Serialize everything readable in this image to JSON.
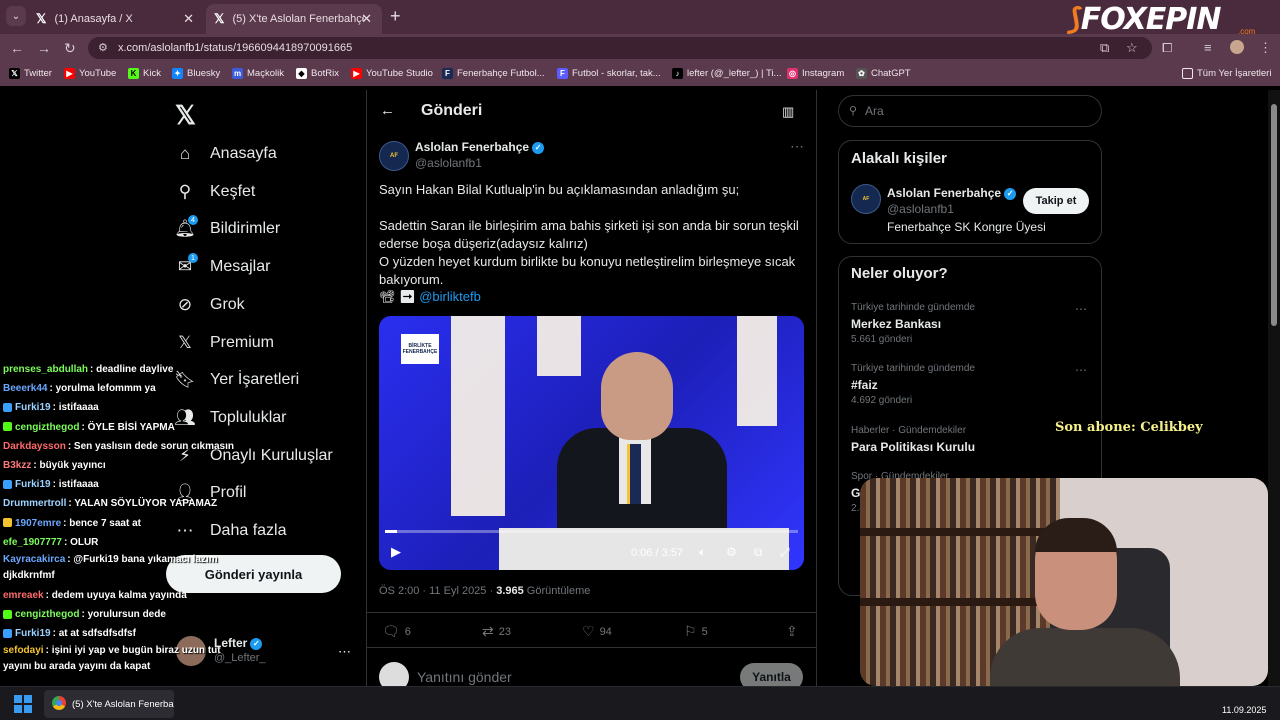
{
  "browser": {
    "tab1": {
      "title": "(1) Anasayfa / X",
      "close": "✕"
    },
    "tab2": {
      "title": "(5) X'te Aslolan Fenerbahçe: \"Sa",
      "close": "✕"
    },
    "new_tab": "+",
    "url": "x.com/aslolanfb1/status/1966094418970091665",
    "bookmarks": [
      {
        "label": "Twitter",
        "color": "#000000",
        "glyph": "X"
      },
      {
        "label": "YouTube",
        "color": "#ff0000",
        "glyph": "▶"
      },
      {
        "label": "Kick",
        "color": "#53fc18",
        "glyph": "K"
      },
      {
        "label": "Bluesky",
        "color": "#1185fe",
        "glyph": "✦"
      },
      {
        "label": "Maçkolik",
        "color": "#3b5bdb",
        "glyph": "m"
      },
      {
        "label": "BotRix",
        "color": "#ffffff",
        "glyph": "◆"
      },
      {
        "label": "YouTube Studio",
        "color": "#ff0000",
        "glyph": "▶"
      },
      {
        "label": "Fenerbahçe Futbol...",
        "color": "#1b2a55",
        "glyph": "F"
      },
      {
        "label": "Futbol - skorlar, tak...",
        "color": "#5b5bff",
        "glyph": "F"
      },
      {
        "label": "lefter (@_lefter_) | Ti...",
        "color": "#000000",
        "glyph": "♪"
      },
      {
        "label": "Instagram",
        "color": "#e1306c",
        "glyph": "◎"
      },
      {
        "label": "ChatGPT",
        "color": "#555555",
        "glyph": "✿"
      }
    ],
    "all_bookmarks": "Tüm Yer İşaretleri"
  },
  "brand": {
    "name": "FOXEPIN",
    "sub": ".com"
  },
  "sidebar": {
    "items": [
      {
        "label": "Anasayfa",
        "icon": "⌂"
      },
      {
        "label": "Keşfet",
        "icon": "⚲"
      },
      {
        "label": "Bildirimler",
        "icon": "🔔︎"
      },
      {
        "label": "Mesajlar",
        "icon": "✉"
      },
      {
        "label": "Grok",
        "icon": "⊘"
      },
      {
        "label": "Premium",
        "icon": "𝕏"
      },
      {
        "label": "Yer İşaretleri",
        "icon": "🔖︎"
      },
      {
        "label": "Topluluklar",
        "icon": "👥︎"
      },
      {
        "label": "Onaylı Kuruluşlar",
        "icon": "⚡︎"
      },
      {
        "label": "Profil",
        "icon": "👤︎"
      },
      {
        "label": "Daha fazla",
        "icon": "⋯"
      }
    ],
    "post_button": "Gönderi yayınla",
    "profile_name": "Lefter",
    "profile_handle": "@_Lefter_"
  },
  "post": {
    "header": "Gönderi",
    "author": "Aslolan Fenerbahçe",
    "handle": "@aslolanfb1",
    "line1": "Sayın Hakan Bilal Kutlualp'in bu açıklamasından anladığım şu;",
    "line2": "Sadettin Saran ile birleşirim ama bahis şirketi işi son anda bir sorun teşkil ederse boşa düşeriz(adaysız kalırız)",
    "line3": "O yüzden heyet kurdum birlikte bu konuyu netleştirelim birleşmeye sıcak bakıyorum.",
    "tag_prefix": "📽 ➡ ",
    "tag": "@birliktefb",
    "video_time": "0:06 / 3:57",
    "video_progress": 0.028,
    "video_logo": "BİRLİKTE FENERBAHÇE",
    "time": "ÖS 2:00 · 11 Eyl 2025 · ",
    "views": "3.965",
    "views_label": " Görüntüleme",
    "replies": "6",
    "reposts": "23",
    "likes": "94",
    "bookmarks": "5",
    "reply_placeholder": "Yanıtını gönder",
    "reply_button": "Yanıtla"
  },
  "right": {
    "search_placeholder": "Ara",
    "related_title": "Alakalı kişiler",
    "related_name": "Aslolan Fenerbahçe",
    "related_handle": "@aslolanfb1",
    "related_desc": "Fenerbahçe SK Kongre Üyesi",
    "follow": "Takip et",
    "trends_title": "Neler oluyor?",
    "trends": [
      {
        "context": "Türkiye tarihinde gündemde",
        "name": "Merkez Bankası",
        "count": "5.661 gönderi"
      },
      {
        "context": "Türkiye tarihinde gündemde",
        "name": "#faiz",
        "count": "4.692 gönderi"
      },
      {
        "context": "Haberler · Gündemdekiler",
        "name": "Para Politikası Kurulu",
        "count": ""
      },
      {
        "context": "Spor · Gündemdekiler",
        "name": "Gö",
        "count": "2.4"
      }
    ]
  },
  "overlay": {
    "subscriber": "Son abone: Celikbey",
    "chat": [
      {
        "user": "prenses_abdullah",
        "color": "#7cfc5c",
        "msg": "deadline daylive",
        "icon": ""
      },
      {
        "user": "Beeerk44",
        "color": "#6aa8ff",
        "msg": "yorulma lefommm ya",
        "icon": ""
      },
      {
        "user": "Furki19",
        "color": "#9bd2ff",
        "msg": "istifaaaa",
        "icon": "#3aa0ff"
      },
      {
        "user": "cengizthegod",
        "color": "#7cfc5c",
        "msg": "ÖYLE BİSİ YAPMA",
        "icon": "#53fc18"
      },
      {
        "user": "Darkdaysson",
        "color": "#ff6b6b",
        "msg": "Sen yaslısın dede sorun cıkmasın",
        "icon": ""
      },
      {
        "user": "B3kzz",
        "color": "#ff7a7a",
        "msg": "büyük yayıncı",
        "icon": ""
      },
      {
        "user": "Furki19",
        "color": "#9bd2ff",
        "msg": "istifaaaa",
        "icon": "#3aa0ff"
      },
      {
        "user": "Drummertroll",
        "color": "#9fd3ff",
        "msg": "YALAN SÖYLÜYOR YAPAMAZ",
        "icon": ""
      },
      {
        "user": "1907emre",
        "color": "#6aa8ff",
        "msg": "bence 7 saat at",
        "icon": "#f4c430"
      },
      {
        "user": "efe_1907777",
        "color": "#7cfc5c",
        "msg": "OLUR",
        "icon": ""
      },
      {
        "user": "Kayracakirca",
        "color": "#6aa8ff",
        "msg": "@Furki19 bana yıkamacı lazım djkdkrnfmf",
        "icon": ""
      },
      {
        "user": "emreaek",
        "color": "#ff6b6b",
        "msg": "dedem uyuya kalma yayında",
        "icon": ""
      },
      {
        "user": "cengizthegod",
        "color": "#7cfc5c",
        "msg": "yorulursun dede",
        "icon": "#53fc18"
      },
      {
        "user": "Furki19",
        "color": "#9bd2ff",
        "msg": "at at sdfsdfsdfsf",
        "icon": "#3aa0ff"
      },
      {
        "user": "sefodayi",
        "color": "#f4c430",
        "msg": "işini iyi yap ve bugün biraz uzun tut yayını bu arada yayını da kapat",
        "icon": ""
      }
    ]
  },
  "taskbar": {
    "app_title": "(5) X'te Aslolan Fenerba",
    "date": "11.09.2025"
  }
}
